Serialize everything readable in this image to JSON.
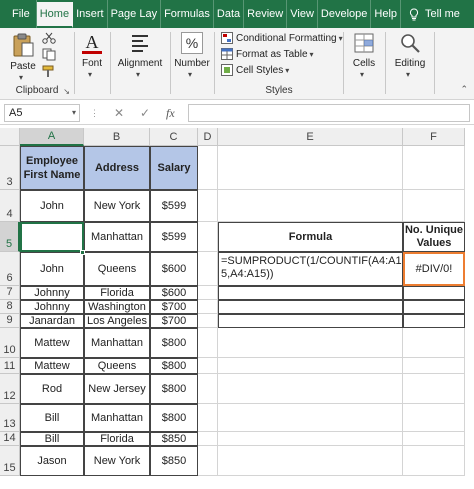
{
  "tabs": [
    "File",
    "Home",
    "Insert",
    "Page Lay",
    "Formulas",
    "Data",
    "Review",
    "View",
    "Develope",
    "Help",
    "Tell me"
  ],
  "active_tab": "Home",
  "ribbon": {
    "paste_label": "Paste",
    "clipboard_label": "Clipboard",
    "font_label": "Font",
    "alignment_label": "Alignment",
    "number_label": "Number",
    "conditional_formatting": "Conditional Formatting",
    "format_as_table": "Format as Table",
    "cell_styles": "Cell Styles",
    "styles_label": "Styles",
    "cells_label": "Cells",
    "editing_label": "Editing",
    "number_icon": "%",
    "font_icon": "A"
  },
  "formula_bar": {
    "name_box": "A5",
    "fx": "fx",
    "cancel": "✕",
    "enter": "✓",
    "value": ""
  },
  "columns": [
    "A",
    "B",
    "C",
    "D",
    "E",
    "F"
  ],
  "selected_column": "A",
  "rows": [
    "3",
    "4",
    "5",
    "6",
    "7",
    "8",
    "9",
    "10",
    "11",
    "12",
    "13",
    "14",
    "15"
  ],
  "selected_row": "5",
  "table": {
    "headers": [
      "Employee First Name",
      "Address",
      "Salary"
    ],
    "rows": [
      [
        "John",
        "New York",
        "$599"
      ],
      [
        "",
        "Manhattan",
        "$599"
      ],
      [
        "John",
        "Queens",
        "$600"
      ],
      [
        "Johnny",
        "Florida",
        "$600"
      ],
      [
        "Johnny",
        "Washington",
        "$700"
      ],
      [
        "Janardan",
        "Los Angeles",
        "$700"
      ],
      [
        "Mattew",
        "Manhattan",
        "$800"
      ],
      [
        "Mattew",
        "Queens",
        "$800"
      ],
      [
        "Rod",
        "New Jersey",
        "$800"
      ],
      [
        "Bill",
        "Manhattan",
        "$800"
      ],
      [
        "Bill",
        "Florida",
        "$850"
      ],
      [
        "Jason",
        "New York",
        "$850"
      ]
    ]
  },
  "formula_table": {
    "header_formula": "Formula",
    "header_result": "No. Unique Values",
    "formula_text": "=SUMPRODUCT(1/COUNTIF(A4:A15,A4:A15))",
    "result": "#DIV/0!"
  },
  "colors": {
    "excel_green": "#217346",
    "header_fill": "#b4c6e7",
    "highlight": "#ed7d31"
  }
}
